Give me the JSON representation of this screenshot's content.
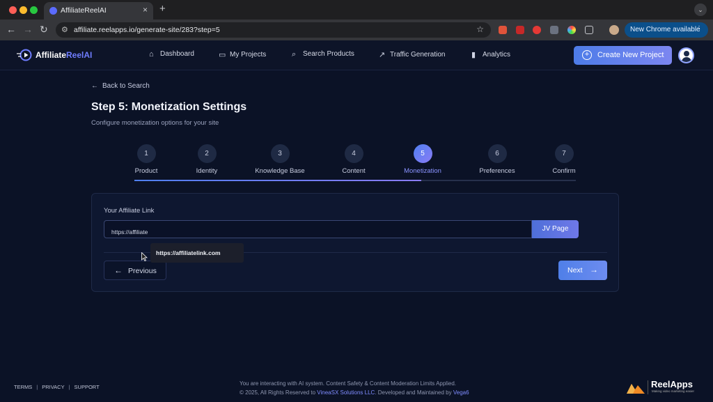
{
  "browser": {
    "tab_title": "AffiliateReelAI",
    "new_tab_symbol": "+",
    "url": "affiliate.reelapps.io/generate-site/283?step=5",
    "update_button": "New Chrome available"
  },
  "header": {
    "logo_main": "Affiliate",
    "logo_accent": "ReelAI",
    "nav": [
      {
        "label": "Dashboard",
        "icon": "home-icon"
      },
      {
        "label": "My Projects",
        "icon": "folder-icon"
      },
      {
        "label": "Search Products",
        "icon": "search-icon"
      },
      {
        "label": "Traffic Generation",
        "icon": "trending-up-icon"
      },
      {
        "label": "Analytics",
        "icon": "bar-chart-icon"
      }
    ],
    "create_button": "Create New Project"
  },
  "main": {
    "back_link": "Back to Search",
    "title": "Step 5: Monetization Settings",
    "subtitle": "Configure monetization options for your site",
    "steps": [
      {
        "number": "1",
        "label": "Product"
      },
      {
        "number": "2",
        "label": "Identity"
      },
      {
        "number": "3",
        "label": "Knowledge Base"
      },
      {
        "number": "4",
        "label": "Content"
      },
      {
        "number": "5",
        "label": "Monetization"
      },
      {
        "number": "6",
        "label": "Preferences"
      },
      {
        "number": "7",
        "label": "Confirm"
      }
    ],
    "active_step": 5,
    "progress_fraction": 0.65,
    "affiliate_link_label": "Your Affiliate Link",
    "affiliate_link_value": "https://affiliate",
    "affiliate_link_suggestion": "https://affiliatelink.com",
    "jv_button": "JV Page",
    "previous_button": "Previous",
    "next_button": "Next"
  },
  "footer": {
    "links": [
      "TERMS",
      "PRIVACY",
      "SUPPORT"
    ],
    "separator": "|",
    "notice_line1": "You are interacting with AI system. Content Safety & Content Moderation Limits Applied.",
    "notice_line2_pre": "© 2025, All Rights Reserved to ",
    "company": "VineaSX Solutions LLC",
    "notice_line2_mid": ". Developed and Maintained by ",
    "developer": "Vega6",
    "brand_name": "ReelApps",
    "brand_tagline": "Making video marketing easier"
  },
  "colors": {
    "background": "#0b1226",
    "accent": "#6f7dff",
    "primary_button": "#4f7fe8"
  }
}
